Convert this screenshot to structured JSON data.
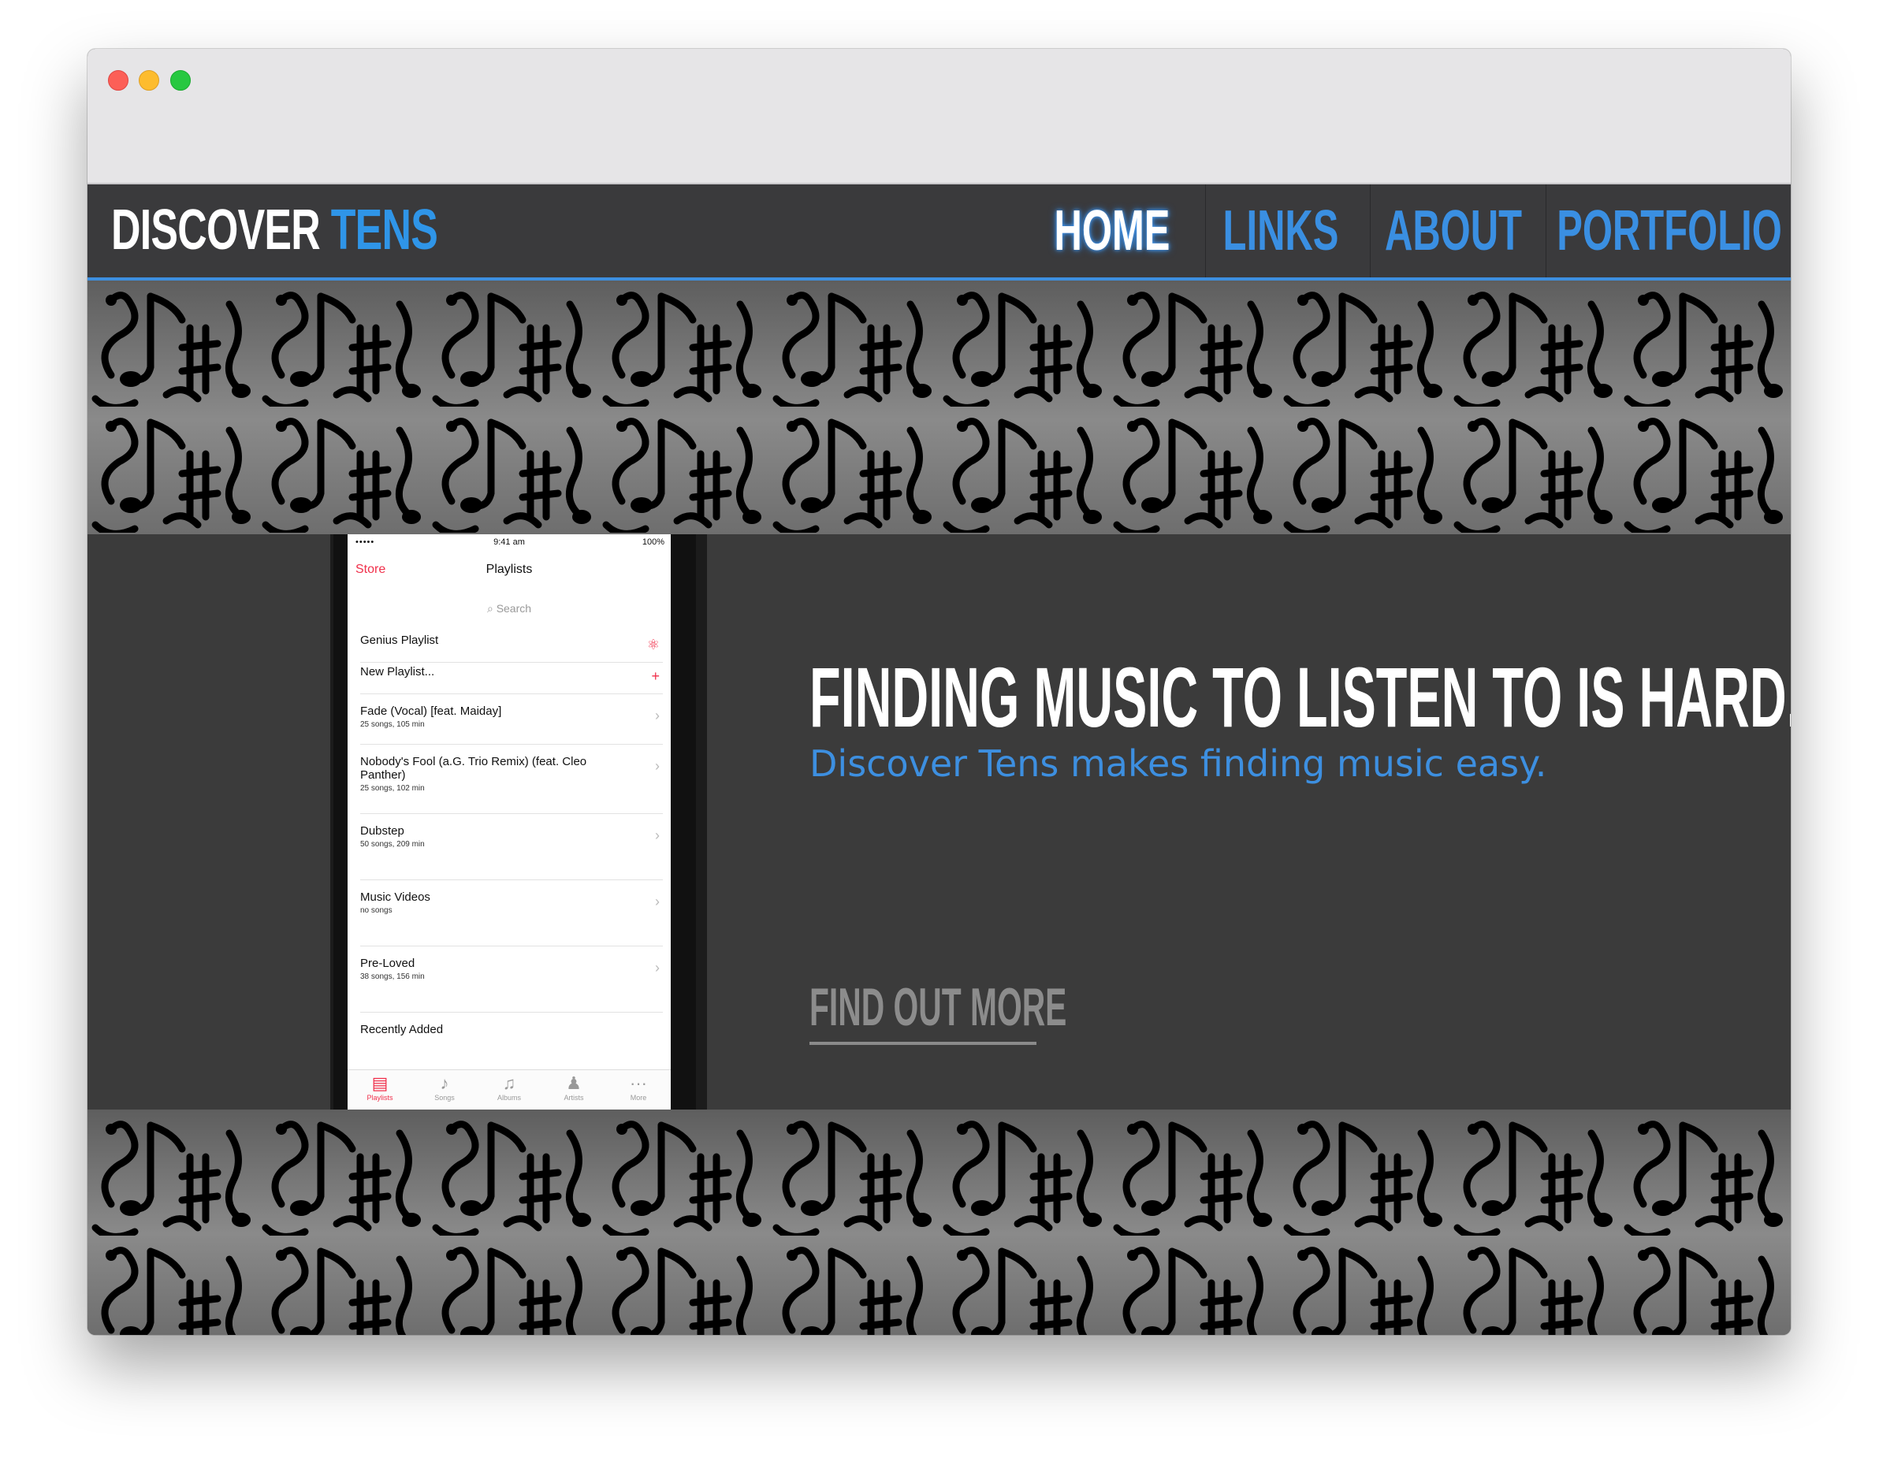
{
  "brand": {
    "part1": "DISCOVER",
    "part2": "TENS"
  },
  "nav": {
    "items": [
      {
        "label": "HOME",
        "active": true
      },
      {
        "label": "LINKS",
        "active": false
      },
      {
        "label": "ABOUT",
        "active": false
      },
      {
        "label": "PORTFOLIO",
        "active": false
      }
    ]
  },
  "hero": {
    "headline": "FINDING MUSIC TO LISTEN TO IS HARD.",
    "subheadline": "Discover Tens makes finding music easy.",
    "cta_label": "FIND OUT MORE"
  },
  "phone": {
    "status_left": "•••••",
    "status_time": "9:41 am",
    "status_right": "100%",
    "back_label": "Store",
    "title": "Playlists",
    "search_placeholder": "Search",
    "rows": [
      {
        "name": "Genius Playlist",
        "sub": ""
      },
      {
        "name": "New Playlist...",
        "sub": ""
      },
      {
        "name": "Fade (Vocal) [feat. Maiday]",
        "sub": "25 songs, 105 min"
      },
      {
        "name": "Nobody's Fool (a.G. Trio Remix) (feat. Cleo Panther)",
        "sub": "25 songs, 102 min"
      },
      {
        "name": "Dubstep",
        "sub": "50 songs, 209 min"
      },
      {
        "name": "Music Videos",
        "sub": "no songs"
      },
      {
        "name": "Pre-Loved",
        "sub": "38 songs, 156 min"
      },
      {
        "name": "Recently Added",
        "sub": ""
      }
    ],
    "tabs": [
      "Playlists",
      "Songs",
      "Albums",
      "Artists",
      "More"
    ]
  },
  "colors": {
    "accent": "#3d8fe0",
    "background": "#3b3b3b",
    "pink": "#f0304b"
  }
}
